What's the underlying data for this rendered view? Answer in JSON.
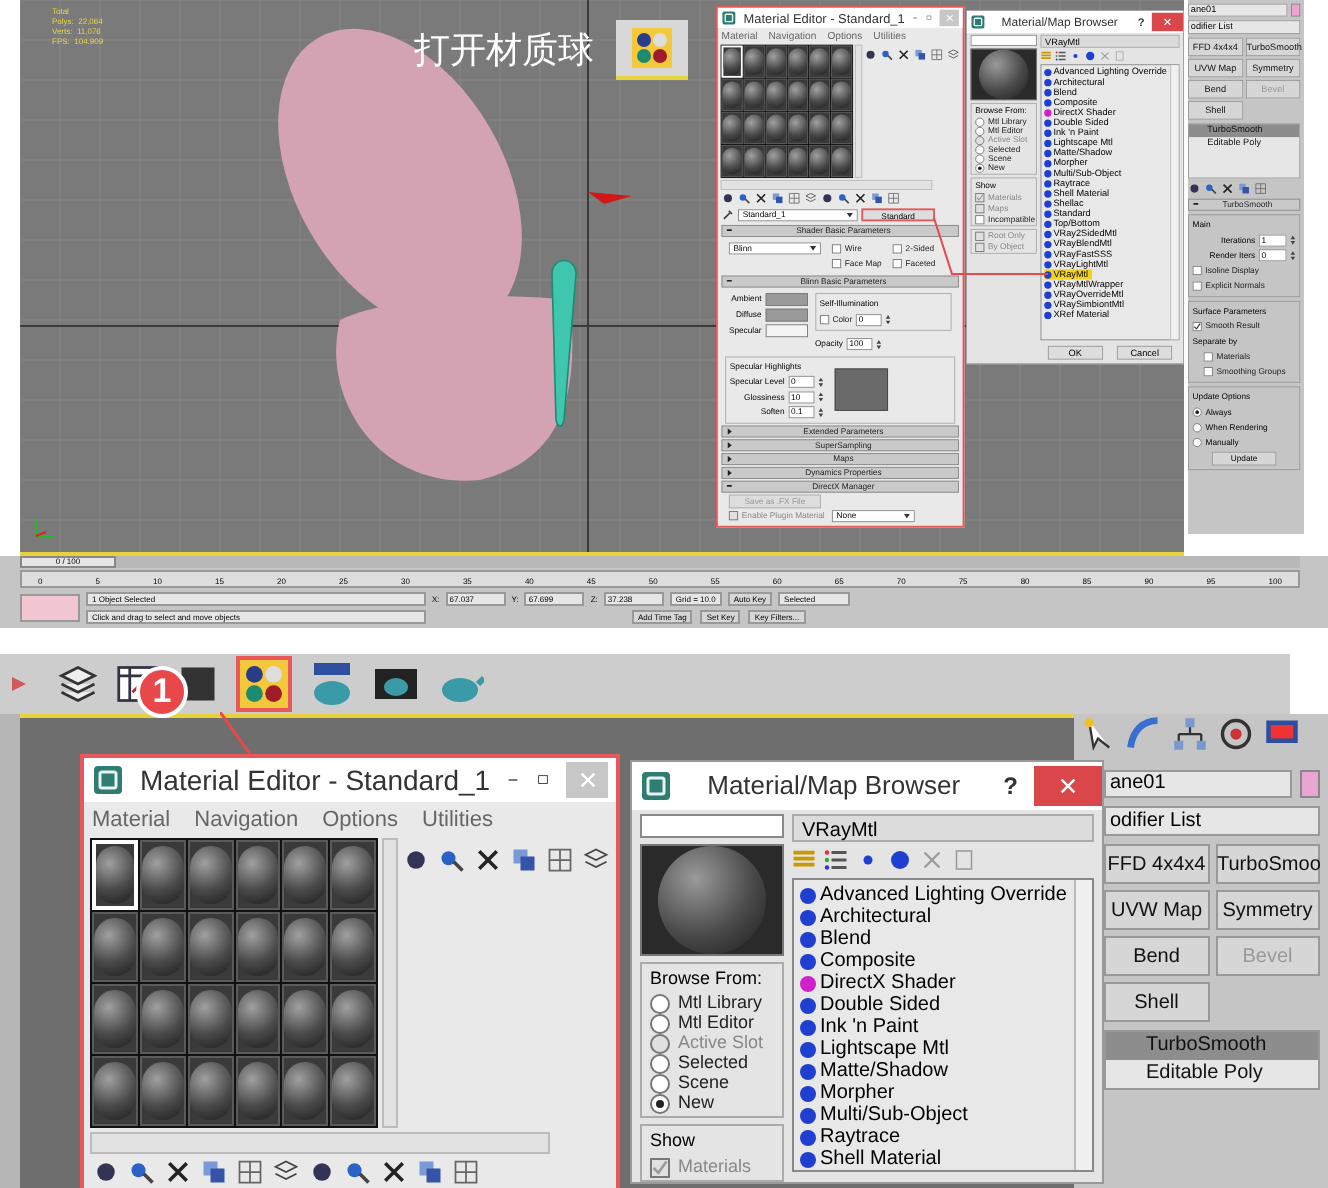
{
  "top": {
    "viewport": {
      "stats": [
        "Total",
        "Polys:  22,064",
        "Verts:  11,076",
        "FPS:  104.909"
      ],
      "caption": "打开材质球"
    },
    "material_editor": {
      "title": "Material Editor - Standard_1",
      "menu": [
        "Material",
        "Navigation",
        "Options",
        "Utilities"
      ],
      "slots": [
        {
          "selected": true
        },
        {
          "selected": false
        },
        {
          "selected": false
        },
        {
          "selected": false
        },
        {
          "selected": false
        },
        {
          "selected": false
        },
        {
          "selected": false
        },
        {
          "selected": false
        },
        {
          "selected": false
        },
        {
          "selected": false
        },
        {
          "selected": false
        },
        {
          "selected": false
        },
        {
          "selected": false
        },
        {
          "selected": false
        },
        {
          "selected": false
        },
        {
          "selected": false
        },
        {
          "selected": false
        },
        {
          "selected": false
        },
        {
          "selected": false
        },
        {
          "selected": false
        },
        {
          "selected": false
        },
        {
          "selected": false
        },
        {
          "selected": false
        },
        {
          "selected": false
        }
      ],
      "material_name": "Standard_1",
      "type_button": "Standard",
      "shader": {
        "header": "Shader Basic Parameters",
        "value": "Blinn",
        "options": [
          {
            "label": "Wire",
            "checked": false
          },
          {
            "label": "2-Sided",
            "checked": false
          },
          {
            "label": "Face Map",
            "checked": false
          },
          {
            "label": "Faceted",
            "checked": false
          }
        ]
      },
      "basic": {
        "header": "Blinn Basic Parameters",
        "colors": [
          "Ambient",
          "Diffuse",
          "Specular"
        ],
        "self_illum": "Self-Illumination",
        "color_option": {
          "label": "Color",
          "checked": false
        },
        "color_value": "0",
        "opacity_label": "Opacity",
        "opacity_value": "100"
      },
      "highlights": {
        "label": "Specular Highlights",
        "fields": [
          {
            "label": "Specular Level",
            "value": "0"
          },
          {
            "label": "Glossiness",
            "value": "10"
          },
          {
            "label": "Soften",
            "value": "0.1"
          }
        ]
      },
      "collapsed": [
        {
          "label": "Extended Parameters",
          "expanded": false
        },
        {
          "label": "SuperSampling",
          "expanded": false
        },
        {
          "label": "Maps",
          "expanded": false
        },
        {
          "label": "Dynamics Properties",
          "expanded": false
        },
        {
          "label": "DirectX Manager",
          "expanded": true
        }
      ],
      "fx_button": "Save as .FX File",
      "plugin": {
        "label": "Enable Plugin Material",
        "checked": false,
        "disabled": true
      },
      "plugin_value": "None"
    },
    "browser": {
      "title": "Material/Map Browser",
      "help": "?",
      "type_name": "VRayMtl",
      "browse_from": {
        "label": "Browse From:",
        "options": [
          {
            "label": "Mtl Library",
            "selected": false,
            "disabled": false
          },
          {
            "label": "Mtl Editor",
            "selected": false,
            "disabled": false
          },
          {
            "label": "Active Slot",
            "selected": false,
            "disabled": true
          },
          {
            "label": "Selected",
            "selected": false,
            "disabled": false
          },
          {
            "label": "Scene",
            "selected": false,
            "disabled": false
          },
          {
            "label": "New",
            "selected": true,
            "disabled": false
          }
        ]
      },
      "show": {
        "label": "Show",
        "options": [
          {
            "label": "Materials",
            "checked": true,
            "disabled": true
          },
          {
            "label": "Maps",
            "checked": false,
            "disabled": true
          },
          {
            "label": "Incompatible",
            "checked": false,
            "disabled": false
          }
        ]
      },
      "view": {
        "options": [
          {
            "label": "Root Only",
            "checked": false,
            "disabled": true
          },
          {
            "label": "By Object",
            "checked": false,
            "disabled": true
          }
        ]
      },
      "items": [
        {
          "label": "Advanced Lighting Override",
          "color": "#1f3fd0",
          "selected": false
        },
        {
          "label": "Architectural",
          "color": "#1f3fd0",
          "selected": false
        },
        {
          "label": "Blend",
          "color": "#1f3fd0",
          "selected": false
        },
        {
          "label": "Composite",
          "color": "#1f3fd0",
          "selected": false
        },
        {
          "label": "DirectX Shader",
          "color": "#d020c8",
          "selected": false
        },
        {
          "label": "Double Sided",
          "color": "#1f3fd0",
          "selected": false
        },
        {
          "label": "Ink 'n Paint",
          "color": "#1f3fd0",
          "selected": false
        },
        {
          "label": "Lightscape Mtl",
          "color": "#1f3fd0",
          "selected": false
        },
        {
          "label": "Matte/Shadow",
          "color": "#1f3fd0",
          "selected": false
        },
        {
          "label": "Morpher",
          "color": "#1f3fd0",
          "selected": false
        },
        {
          "label": "Multi/Sub-Object",
          "color": "#1f3fd0",
          "selected": false
        },
        {
          "label": "Raytrace",
          "color": "#1f3fd0",
          "selected": false
        },
        {
          "label": "Shell Material",
          "color": "#1f3fd0",
          "selected": false
        },
        {
          "label": "Shellac",
          "color": "#1f3fd0",
          "selected": false
        },
        {
          "label": "Standard",
          "color": "#1f3fd0",
          "selected": false
        },
        {
          "label": "Top/Bottom",
          "color": "#1f3fd0",
          "selected": false
        },
        {
          "label": "VRay2SidedMtl",
          "color": "#1f3fd0",
          "selected": false
        },
        {
          "label": "VRayBlendMtl",
          "color": "#1f3fd0",
          "selected": false
        },
        {
          "label": "VRayFastSSS",
          "color": "#1f3fd0",
          "selected": false
        },
        {
          "label": "VRayLightMtl",
          "color": "#1f3fd0",
          "selected": false
        },
        {
          "label": "VRayMtl",
          "color": "#1f3fd0",
          "selected": true
        },
        {
          "label": "VRayMtlWrapper",
          "color": "#1f3fd0",
          "selected": false
        },
        {
          "label": "VRayOverrideMtl",
          "color": "#1f3fd0",
          "selected": false
        },
        {
          "label": "VRaySimbiontMtl",
          "color": "#1f3fd0",
          "selected": false
        },
        {
          "label": "XRef Material",
          "color": "#1f3fd0",
          "selected": false
        }
      ],
      "buttons": [
        "OK",
        "Cancel"
      ]
    },
    "command_panel": {
      "object_name": "ane01",
      "modifier_list": "odifier List",
      "modifiers": [
        {
          "label": "FFD 4x4x4",
          "disabled": false
        },
        {
          "label": "TurboSmooth",
          "disabled": false
        },
        {
          "label": "UVW Map",
          "disabled": false
        },
        {
          "label": "Symmetry",
          "disabled": false
        },
        {
          "label": "Bend",
          "disabled": false
        },
        {
          "label": "Bevel",
          "disabled": true
        },
        {
          "label": "Shell",
          "disabled": false
        }
      ],
      "stack": [
        {
          "label": "TurboSmooth",
          "selected": true
        },
        {
          "label": "Editable Poly",
          "selected": false
        }
      ],
      "rollout": {
        "title": "TurboSmooth",
        "main": "Main",
        "fields": [
          {
            "label": "Iterations",
            "value": "1"
          },
          {
            "label": "Render Iters",
            "value": "0"
          }
        ],
        "checks": [
          {
            "label": "Isoline Display",
            "checked": false
          },
          {
            "label": "Explicit Normals",
            "checked": false
          }
        ],
        "surface": "Surface Parameters",
        "smooth": {
          "label": "Smooth Result",
          "checked": true
        },
        "separate": "Separate by",
        "separate_checks": [
          {
            "label": "Materials",
            "checked": false
          },
          {
            "label": "Smoothing Groups",
            "checked": false
          }
        ],
        "update": "Update Options",
        "update_options": [
          {
            "label": "Always",
            "selected": true
          },
          {
            "label": "When Rendering",
            "selected": false
          },
          {
            "label": "Manually",
            "selected": false
          }
        ],
        "update_button": "Update"
      }
    },
    "timeline": {
      "frame": "0 / 100",
      "level": 0,
      "ticks": [
        "0",
        "5",
        "10",
        "15",
        "20",
        "25",
        "30",
        "35",
        "40",
        "45",
        "50",
        "55",
        "60",
        "65",
        "70",
        "75",
        "80",
        "85",
        "90",
        "95",
        "100"
      ]
    },
    "status": {
      "selection": "1 Object Selected",
      "prompt": "Click and drag to select and move objects",
      "coords": [
        {
          "axis": "X:",
          "value": "67.037"
        },
        {
          "axis": "Y:",
          "value": "67.699"
        },
        {
          "axis": "Z:",
          "value": "37.238"
        }
      ],
      "grid": "Grid = 10.0",
      "auto_key": "Auto Key",
      "key_mode": "Selected",
      "set_key": "Set Key",
      "key_filters": "Key Filters...",
      "time_tag": "Add Time Tag"
    }
  },
  "bottom": {
    "step_badge": "1",
    "material_editor": {
      "title": "Material Editor - Standard_1",
      "menu": [
        "Material",
        "Navigation",
        "Options",
        "Utilities"
      ],
      "slots": [
        {
          "selected": true
        },
        {
          "selected": false
        },
        {
          "selected": false
        },
        {
          "selected": false
        },
        {
          "selected": false
        },
        {
          "selected": false
        },
        {
          "selected": false
        },
        {
          "selected": false
        },
        {
          "selected": false
        },
        {
          "selected": false
        },
        {
          "selected": false
        },
        {
          "selected": false
        },
        {
          "selected": false
        },
        {
          "selected": false
        },
        {
          "selected": false
        },
        {
          "selected": false
        },
        {
          "selected": false
        },
        {
          "selected": false
        },
        {
          "selected": false
        },
        {
          "selected": false
        },
        {
          "selected": false
        },
        {
          "selected": false
        },
        {
          "selected": false
        },
        {
          "selected": false
        }
      ]
    },
    "browser": {
      "title": "Material/Map Browser",
      "help": "?",
      "type_name": "VRayMtl",
      "browse_from": {
        "label": "Browse From:",
        "options": [
          {
            "label": "Mtl Library",
            "selected": false,
            "disabled": false
          },
          {
            "label": "Mtl Editor",
            "selected": false,
            "disabled": false
          },
          {
            "label": "Active Slot",
            "selected": false,
            "disabled": true
          },
          {
            "label": "Selected",
            "selected": false,
            "disabled": false
          },
          {
            "label": "Scene",
            "selected": false,
            "disabled": false
          },
          {
            "label": "New",
            "selected": true,
            "disabled": false
          }
        ]
      },
      "show": {
        "label": "Show",
        "options": [
          {
            "label": "Materials",
            "checked": true,
            "disabled": true
          }
        ]
      },
      "items": [
        {
          "label": "Advanced Lighting Override",
          "color": "#1f3fd0",
          "selected": false
        },
        {
          "label": "Architectural",
          "color": "#1f3fd0",
          "selected": false
        },
        {
          "label": "Blend",
          "color": "#1f3fd0",
          "selected": false
        },
        {
          "label": "Composite",
          "color": "#1f3fd0",
          "selected": false
        },
        {
          "label": "DirectX Shader",
          "color": "#d020c8",
          "selected": false
        },
        {
          "label": "Double Sided",
          "color": "#1f3fd0",
          "selected": false
        },
        {
          "label": "Ink 'n Paint",
          "color": "#1f3fd0",
          "selected": false
        },
        {
          "label": "Lightscape Mtl",
          "color": "#1f3fd0",
          "selected": false
        },
        {
          "label": "Matte/Shadow",
          "color": "#1f3fd0",
          "selected": false
        },
        {
          "label": "Morpher",
          "color": "#1f3fd0",
          "selected": false
        },
        {
          "label": "Multi/Sub-Object",
          "color": "#1f3fd0",
          "selected": false
        },
        {
          "label": "Raytrace",
          "color": "#1f3fd0",
          "selected": false
        },
        {
          "label": "Shell Material",
          "color": "#1f3fd0",
          "selected": false
        }
      ]
    },
    "command_panel": {
      "object_name": "ane01",
      "modifier_list": "odifier List",
      "modifiers": [
        {
          "label": "FFD 4x4x4",
          "disabled": false
        },
        {
          "label": "TurboSmoo",
          "disabled": false
        },
        {
          "label": "UVW Map",
          "disabled": false
        },
        {
          "label": "Symmetry",
          "disabled": false
        },
        {
          "label": "Bend",
          "disabled": false
        },
        {
          "label": "Bevel",
          "disabled": true
        },
        {
          "label": "Shell",
          "disabled": false
        }
      ],
      "stack": [
        {
          "label": "TurboSmooth",
          "selected": true
        },
        {
          "label": "Editable Poly",
          "selected": false
        }
      ]
    }
  }
}
